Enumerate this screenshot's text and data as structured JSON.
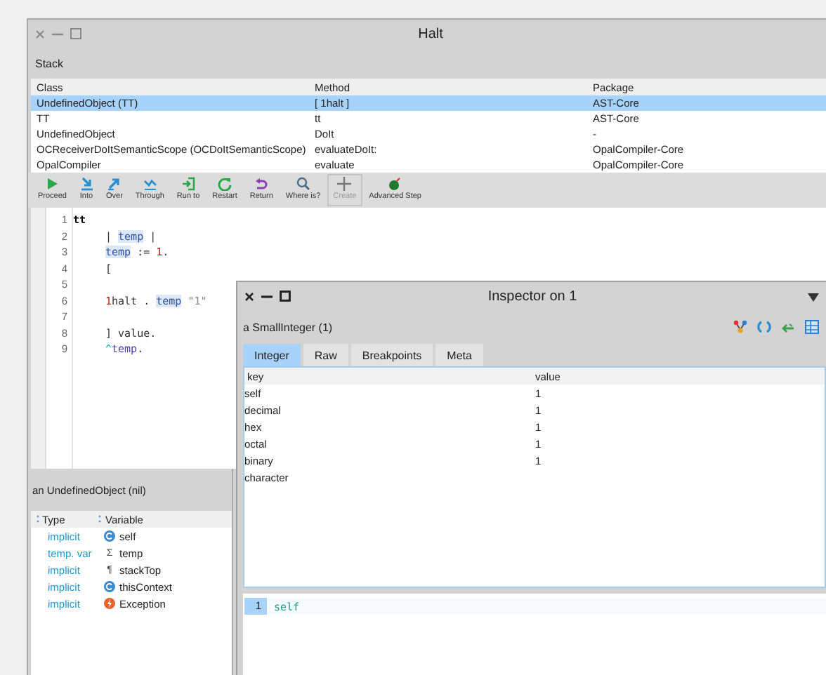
{
  "window": {
    "title": "Halt"
  },
  "stack": {
    "label": "Stack",
    "columns": [
      "Class",
      "Method",
      "Package"
    ],
    "rows": [
      {
        "cells": [
          "UndefinedObject (TT)",
          "[ 1halt ]",
          "AST-Core"
        ],
        "selected": true
      },
      {
        "cells": [
          "TT",
          "tt",
          "AST-Core"
        ],
        "selected": false
      },
      {
        "cells": [
          "UndefinedObject",
          "DoIt",
          "-"
        ],
        "selected": false
      },
      {
        "cells": [
          "OCReceiverDoItSemanticScope (OCDoItSemanticScope)",
          "evaluateDoIt:",
          "OpalCompiler-Core"
        ],
        "selected": false
      },
      {
        "cells": [
          "OpalCompiler",
          "evaluate",
          "OpalCompiler-Core"
        ],
        "selected": false
      }
    ]
  },
  "toolbar": [
    {
      "label": "Proceed",
      "kind": "proceed",
      "disabled": false
    },
    {
      "label": "Into",
      "kind": "into",
      "disabled": false
    },
    {
      "label": "Over",
      "kind": "over",
      "disabled": false
    },
    {
      "label": "Through",
      "kind": "through",
      "disabled": false
    },
    {
      "label": "Run to",
      "kind": "runto",
      "disabled": false
    },
    {
      "label": "Restart",
      "kind": "restart",
      "disabled": false
    },
    {
      "label": "Return",
      "kind": "return",
      "disabled": false
    },
    {
      "label": "Where is?",
      "kind": "where",
      "disabled": false
    },
    {
      "label": "Create",
      "kind": "create",
      "disabled": true
    },
    {
      "label": "Advanced Step",
      "kind": "advanced",
      "disabled": false
    }
  ],
  "code": [
    {
      "number": "1",
      "indented": false,
      "tokens": [
        {
          "text": "tt",
          "kind": "selector"
        }
      ]
    },
    {
      "number": "2",
      "indented": true,
      "tokens": [
        {
          "text": "| ",
          "kind": "plain"
        },
        {
          "text": "temp",
          "kind": "var-hl"
        },
        {
          "text": " |",
          "kind": "plain"
        }
      ]
    },
    {
      "number": "3",
      "indented": true,
      "tokens": [
        {
          "text": "temp",
          "kind": "var-hl"
        },
        {
          "text": " := ",
          "kind": "plain"
        },
        {
          "text": "1",
          "kind": "number"
        },
        {
          "text": ".",
          "kind": "plain"
        }
      ]
    },
    {
      "number": "4",
      "indented": true,
      "tokens": [
        {
          "text": "[",
          "kind": "plain"
        }
      ]
    },
    {
      "number": "5"
    },
    {
      "number": "6",
      "indented": true,
      "tokens": [
        {
          "text": "1",
          "kind": "number"
        },
        {
          "text": "halt . ",
          "kind": "plain"
        },
        {
          "text": "temp",
          "kind": "var-hl"
        },
        {
          "text": " \"1\"",
          "kind": "comment"
        }
      ]
    },
    {
      "number": "7"
    },
    {
      "number": "8",
      "indented": true,
      "tokens": [
        {
          "text": "] value.",
          "kind": "plain"
        }
      ]
    },
    {
      "number": "9",
      "indented": true,
      "tokens": [
        {
          "text": "^",
          "kind": "return"
        },
        {
          "text": "temp",
          "kind": "var"
        },
        {
          "text": ".",
          "kind": "plain"
        }
      ]
    }
  ],
  "context": {
    "label": "an UndefinedObject (nil)",
    "columns": [
      "Type",
      "Variable"
    ],
    "rows": [
      {
        "type": "implicit",
        "kind": "class",
        "variable": "self"
      },
      {
        "type": "temp. var",
        "kind": "symbol",
        "symbol": "Σ",
        "variable": "temp"
      },
      {
        "type": "implicit",
        "kind": "symbol",
        "symbol": "¶",
        "variable": "stackTop"
      },
      {
        "type": "implicit",
        "kind": "class",
        "variable": "thisContext"
      },
      {
        "type": "implicit",
        "kind": "exception",
        "variable": "Exception"
      }
    ]
  },
  "inspector": {
    "title": "Inspector on 1",
    "subject": "a SmallInteger (1)",
    "tabs": [
      {
        "label": "Integer",
        "selected": true
      },
      {
        "label": "Raw",
        "selected": false
      },
      {
        "label": "Breakpoints",
        "selected": false
      },
      {
        "label": "Meta",
        "selected": false
      }
    ],
    "columns": [
      "key",
      "value"
    ],
    "rows": [
      {
        "key": "self",
        "value": "1"
      },
      {
        "key": "decimal",
        "value": "1"
      },
      {
        "key": "hex",
        "value": "1"
      },
      {
        "key": "octal",
        "value": "1"
      },
      {
        "key": "binary",
        "value": "1"
      },
      {
        "key": "character"
      }
    ],
    "code": [
      {
        "number": "1",
        "text": "self"
      }
    ]
  }
}
